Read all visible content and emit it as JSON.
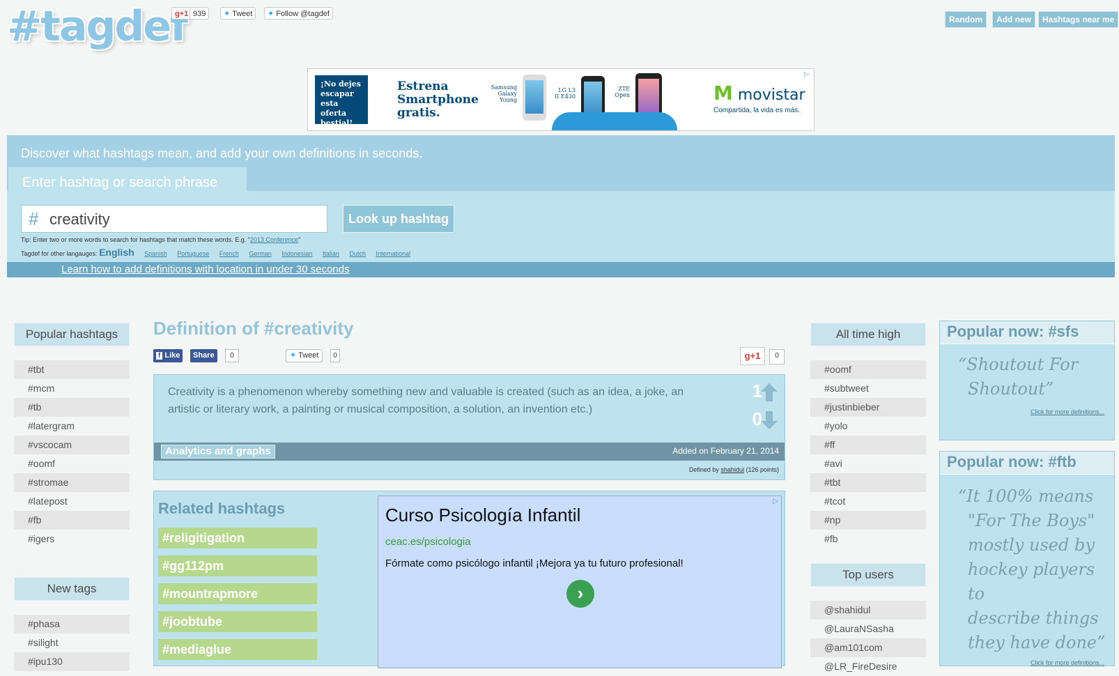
{
  "header": {
    "logo": "#tagdef",
    "gplus_label": "g+1",
    "gplus_count": "939",
    "tweet_label": "Tweet",
    "follow_label": "Follow @tagdef",
    "nav": [
      "Random",
      "Add new",
      "Hashtags near me"
    ]
  },
  "banner": {
    "box_text": "¡No dejes escapar esta oferta bestial!",
    "headline_1": "Estrena",
    "headline_2": "Smartphone",
    "headline_3": "gratis.",
    "phones": [
      {
        "label_1": "Samsung",
        "label_2": "Galaxy",
        "label_3": "Young"
      },
      {
        "label_1": "LG L3",
        "label_2": "II E430",
        "label_3": ""
      },
      {
        "label_1": "ZTE",
        "label_2": "Open",
        "label_3": ""
      }
    ],
    "brand": "movistar",
    "tagline": "Compartida, la vida es más."
  },
  "hero": {
    "discover": "Discover what hashtags mean, and add your own definitions in seconds.",
    "enter_label": "Enter hashtag or search phrase",
    "search_hash": "#",
    "search_value": "creativity",
    "lookup_button": "Look up hashtag",
    "tip_text": "Tip: Enter two or more words to search for hashtags that match these words. E.g. \"",
    "tip_example": "2013 Conference",
    "tip_end": "\"",
    "langs_label": "Tagdef for other langauges:",
    "current_lang": "English",
    "languages": [
      "Spanish",
      "Portuguese",
      "French",
      "German",
      "Indonesian",
      "Italian",
      "Dutch",
      "International"
    ],
    "learn_link": "Learn how to add definitions with location in under 30 seconds"
  },
  "left": {
    "popular_title": "Popular hashtags",
    "popular": [
      "#tbt",
      "#mcm",
      "#tb",
      "#latergram",
      "#vscocam",
      "#oomf",
      "#stromae",
      "#latepost",
      "#fb",
      "#igers"
    ],
    "new_title": "New tags",
    "new_tags": [
      "#phasa",
      "#silight",
      "#ipu130"
    ]
  },
  "definition": {
    "title": "Definition of #creativity",
    "fb_like": "Like",
    "fb_share": "Share",
    "fb_count": "0",
    "tweet_label": "Tweet",
    "tweet_count": "0",
    "gplus_label": "g+1",
    "gplus_count": "0",
    "text": "Creativity is a phenomenon whereby something new and valuable is created (such as an idea, a joke, an artistic or literary work, a painting or musical composition, a solution, an invention etc.)",
    "up_votes": "1",
    "down_votes": "0",
    "analytics_label": "Analytics and graphs",
    "added": "Added on February 21, 2014",
    "defined_by_prefix": "Defined by",
    "defined_by_user": "shahidul",
    "defined_by_points": "(126 points)"
  },
  "related": {
    "title": "Related hashtags",
    "items": [
      "#religitigation",
      "#gg112pm",
      "#mountrapmore",
      "#joobtube",
      "#mediaglue"
    ],
    "ad": {
      "title": "Curso Psicología Infantil",
      "url": "ceac.es/psicologia",
      "desc": "Fórmate como psicólogo infantil ¡Mejora ya tu futuro profesional!"
    }
  },
  "right": {
    "alltime_title": "All time high",
    "alltime": [
      "#oomf",
      "#subtweet",
      "#justinbieber",
      "#yolo",
      "#ff",
      "#avi",
      "#tbt",
      "#tcot",
      "#np",
      "#fb"
    ],
    "users_title": "Top users",
    "users": [
      "@shahidul",
      "@LauraNSasha",
      "@am101com",
      "@LR_FireDesire"
    ]
  },
  "popular_now": [
    {
      "title": "Popular now: #sfs",
      "quote_lines": [
        "Shoutout For",
        "Shoutout"
      ],
      "more": "Click for more definitions..."
    },
    {
      "title": "Popular now: #ftb",
      "quote_lines": [
        "It 100% means",
        "\"For The Boys\"",
        "mostly used by",
        "hockey players to",
        "describe things",
        "they have done"
      ],
      "more": "Click for more definitions..."
    }
  ]
}
